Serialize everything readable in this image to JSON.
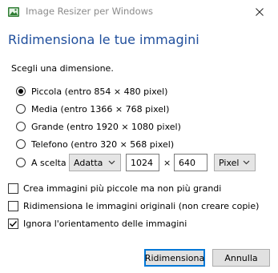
{
  "window": {
    "title": "Image Resizer per Windows"
  },
  "heading": "Ridimensiona le tue immagini",
  "prompt": "Scegli una dimensione.",
  "sizes": [
    {
      "label": "Piccola (entro 854 × 480 pixel)",
      "checked": true
    },
    {
      "label": "Media (entro 1366 × 768 pixel)",
      "checked": false
    },
    {
      "label": "Grande (entro 1920 × 1080 pixel)",
      "checked": false
    },
    {
      "label": "Telefono (entro 320 × 568 pixel)",
      "checked": false
    }
  ],
  "custom": {
    "label": "A scelta",
    "fit_mode": "Adatta",
    "width": "1024",
    "separator": "×",
    "height": "640",
    "unit": "Pixel"
  },
  "options": [
    {
      "label": "Crea immagini più piccole ma non più grandi",
      "checked": false
    },
    {
      "label": "Ridimensiona le immagini originali (non creare copie)",
      "checked": false
    },
    {
      "label": "Ignora l'orientamento delle immagini",
      "checked": true
    }
  ],
  "buttons": {
    "resize": "Ridimensiona",
    "cancel": "Annulla"
  }
}
